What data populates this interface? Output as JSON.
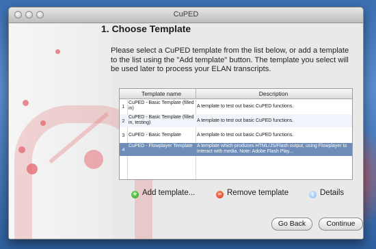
{
  "window": {
    "title": "CuPED"
  },
  "step": {
    "title": "1. Choose Template"
  },
  "intro": "Please select a CuPED template from the list below, or add a template to the list using the \"Add template\" button.  The template you select will be used later to process your ELAN transcripts.",
  "table": {
    "columns": [
      "Template name",
      "Description"
    ],
    "rows": [
      {
        "num": "1",
        "name": "CuPED - Basic Template (filled in)",
        "desc": "A template to test out basic CuPED functions."
      },
      {
        "num": "2",
        "name": "CuPED - Basic Template (filled in, testing)",
        "desc": "A template to test out basic CuPED functions."
      },
      {
        "num": "3",
        "name": "CuPED - Basic Template",
        "desc": "A template to test out basic CuPED functions."
      },
      {
        "num": "4",
        "name": "CuPED - Flowplayer Template",
        "desc": "A template which produces HTML/JS/Flash output, using Flowplayer to interact with media.  Note: Adobe Flash Play..."
      }
    ],
    "selected_index": 3
  },
  "actions": {
    "add": "Add template...",
    "remove": "Remove template",
    "details": "Details"
  },
  "buttons": {
    "back": "Go Back",
    "continue": "Continue"
  },
  "icons": {
    "add": "plus-icon",
    "remove": "minus-icon",
    "details": "info-icon"
  }
}
